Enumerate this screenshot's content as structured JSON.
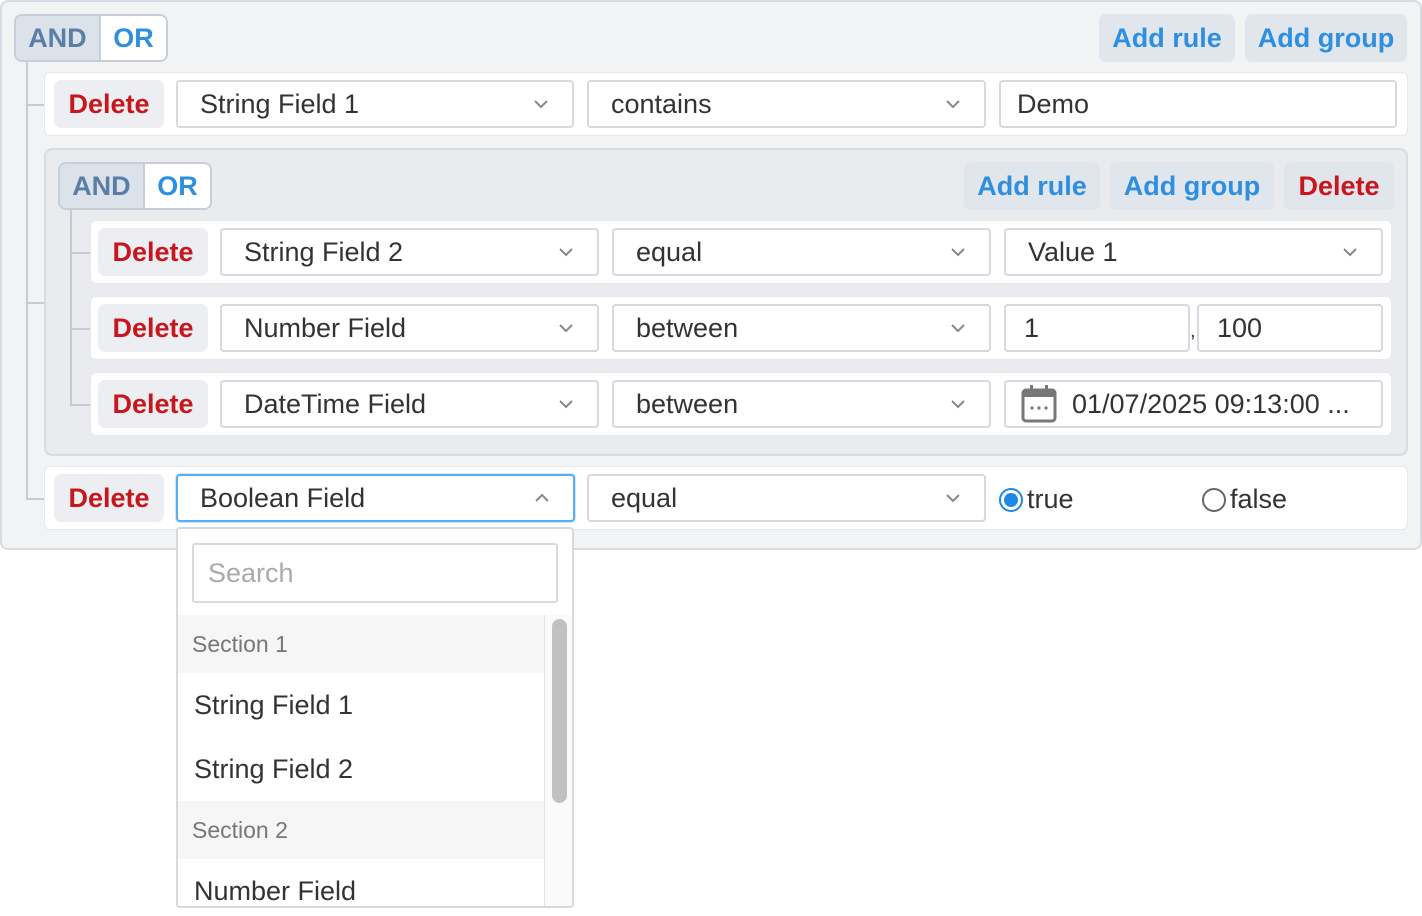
{
  "root": {
    "conjunctions": {
      "and": "AND",
      "or": "OR",
      "active": "AND"
    },
    "add_rule": "Add rule",
    "add_group": "Add group",
    "rules": [
      {
        "delete": "Delete",
        "field": "String Field 1",
        "operator": "contains",
        "value": "Demo"
      },
      {
        "delete": "Delete",
        "field": "Boolean Field",
        "operator": "equal",
        "radio_true": "true",
        "radio_false": "false",
        "selected": "true"
      }
    ]
  },
  "subgroup": {
    "conjunctions": {
      "and": "AND",
      "or": "OR",
      "active": "AND"
    },
    "add_rule": "Add rule",
    "add_group": "Add group",
    "delete": "Delete",
    "rules": [
      {
        "delete": "Delete",
        "field": "String Field 2",
        "operator": "equal",
        "value": "Value 1"
      },
      {
        "delete": "Delete",
        "field": "Number Field",
        "operator": "between",
        "value_from": "1",
        "separator": ",",
        "value_to": "100"
      },
      {
        "delete": "Delete",
        "field": "DateTime Field",
        "operator": "between",
        "value": "01/07/2025 09:13:00 ..."
      }
    ]
  },
  "dropdown": {
    "search_placeholder": "Search",
    "sections": [
      {
        "label": "Section 1",
        "items": [
          "String Field 1",
          "String Field 2"
        ]
      },
      {
        "label": "Section 2",
        "items": [
          "Number Field"
        ]
      }
    ]
  },
  "colors": {
    "accent_blue": "#2e8fe0",
    "delete_red": "#c8161d",
    "radio_blue": "#1e88e5"
  },
  "icons": {
    "chevron": "chevron-down-icon",
    "chevron_open": "chevron-up-icon",
    "calendar": "calendar-icon"
  }
}
